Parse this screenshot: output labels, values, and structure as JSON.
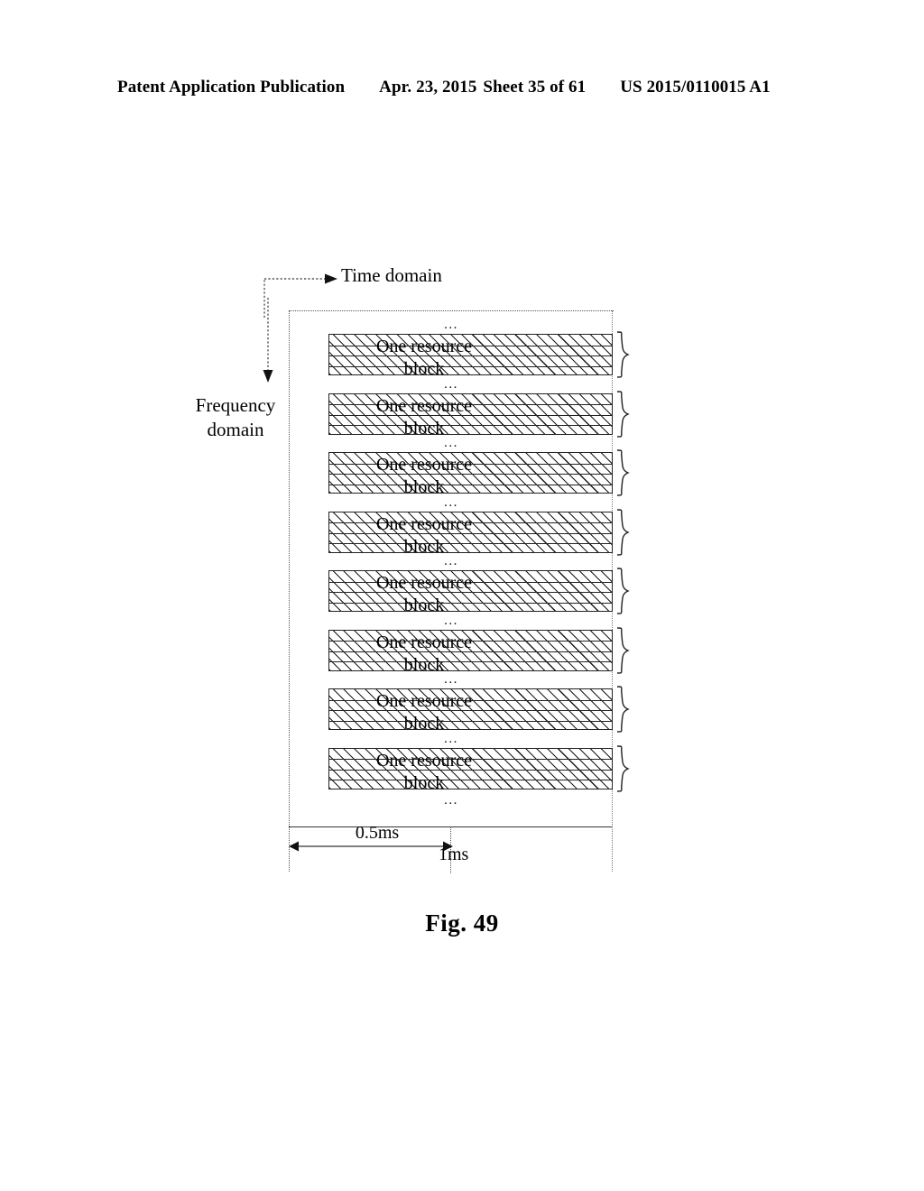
{
  "header": {
    "publication": "Patent Application Publication",
    "date": "Apr. 23, 2015",
    "sheet": "Sheet 35 of 61",
    "pub_number": "US 2015/0110015 A1"
  },
  "figure": {
    "caption": "Fig. 49",
    "axes": {
      "time_domain_label": "Time domain",
      "frequency_domain_label_line1": "Frequency",
      "frequency_domain_label_line2": "domain"
    },
    "timing": {
      "half_slot_label": "0.5ms",
      "subframe_label": "1ms"
    },
    "block_label_line1": "One resource",
    "block_label_line2": "block",
    "ellipsis": "...",
    "blocks": [
      {
        "id": 1,
        "label_line1": "One resource",
        "label_line2": "block"
      },
      {
        "id": 2,
        "label_line1": "One resource",
        "label_line2": "block"
      },
      {
        "id": 3,
        "label_line1": "One resource",
        "label_line2": "block"
      },
      {
        "id": 4,
        "label_line1": "One resource",
        "label_line2": "block"
      },
      {
        "id": 5,
        "label_line1": "One resource",
        "label_line2": "block"
      },
      {
        "id": 6,
        "label_line1": "One resource",
        "label_line2": "block"
      },
      {
        "id": 7,
        "label_line1": "One resource",
        "label_line2": "block"
      },
      {
        "id": 8,
        "label_line1": "One resource",
        "label_line2": "block"
      }
    ],
    "sub_rows_per_block": 4,
    "colors": {
      "ink": "#000000",
      "hatch": "#1a1a1a",
      "dotted_guide": "#555555",
      "page_background": "#ffffff"
    }
  }
}
